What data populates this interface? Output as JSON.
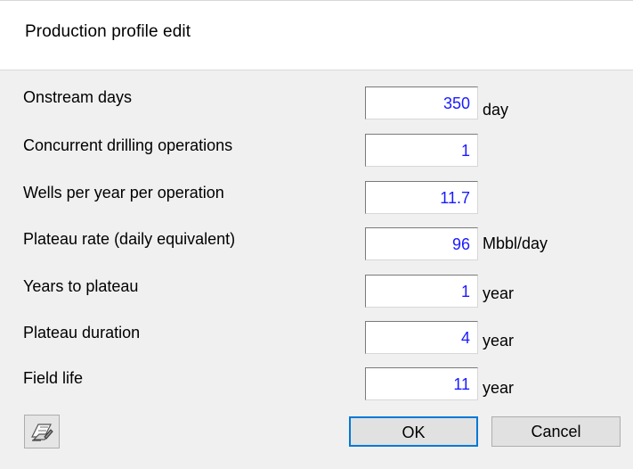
{
  "dialog": {
    "title": "Production profile edit"
  },
  "form": {
    "rows": [
      {
        "label": "Onstream days",
        "value": "350",
        "unit": "day"
      },
      {
        "label": "Concurrent drilling operations",
        "value": "1",
        "unit": ""
      },
      {
        "label": "Wells per year per operation",
        "value": "11.7",
        "unit": ""
      },
      {
        "label": "Plateau rate (daily equivalent)",
        "value": "96",
        "unit": "Mbbl/day"
      },
      {
        "label": "Years to plateau",
        "value": "1",
        "unit": "year"
      },
      {
        "label": "Plateau duration",
        "value": "4",
        "unit": "year"
      },
      {
        "label": "Field life",
        "value": "11",
        "unit": "year"
      }
    ]
  },
  "buttons": {
    "ok_label": "OK",
    "cancel_label": "Cancel",
    "tool_icon": "print-settings-icon"
  },
  "colors": {
    "value_text": "#1a1aff",
    "ok_border": "#0078d7"
  }
}
